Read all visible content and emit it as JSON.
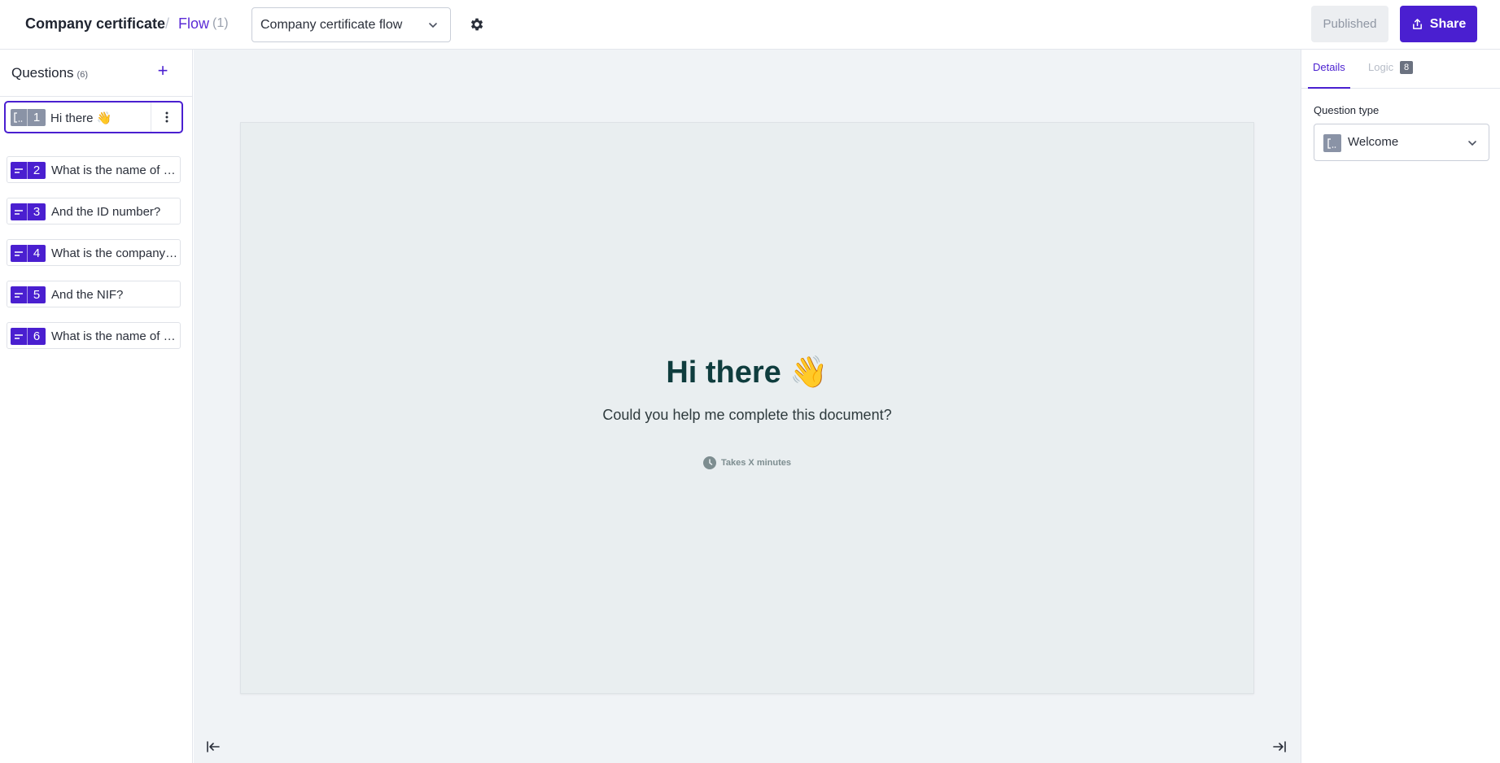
{
  "header": {
    "doc_title": "Company certificate",
    "breadcrumb_sep": "/",
    "flow_label": "Flow",
    "flow_count": "(1)",
    "flow_select_value": "Company certificate flow",
    "published_label": "Published",
    "share_label": "Share"
  },
  "sidebar": {
    "title": "Questions",
    "count": "(6)",
    "items": [
      {
        "num": "1",
        "text": "Hi there 👋",
        "icon": "bracket-icon"
      },
      {
        "num": "2",
        "text": "What is the name of the company?",
        "icon": "text-lines-icon"
      },
      {
        "num": "3",
        "text": "And the ID number?",
        "icon": "text-lines-icon"
      },
      {
        "num": "4",
        "text": "What is the company address?",
        "icon": "text-lines-icon"
      },
      {
        "num": "5",
        "text": "And the NIF?",
        "icon": "text-lines-icon"
      },
      {
        "num": "6",
        "text": "What is the name of the representative?",
        "icon": "text-lines-icon"
      }
    ]
  },
  "preview": {
    "title": "Hi there 👋",
    "subtitle": "Could you help me complete this document?",
    "time_note": "Takes X minutes"
  },
  "right_panel": {
    "tab_details": "Details",
    "tab_logic": "Logic",
    "logic_badge": "8",
    "question_type_label": "Question type",
    "question_type_value": "Welcome"
  },
  "colors": {
    "accent": "#4a1fd0",
    "welcome_title": "#0f3d3e",
    "canvas_bg": "#f0f3f6",
    "preview_bg": "#e9eef0"
  }
}
